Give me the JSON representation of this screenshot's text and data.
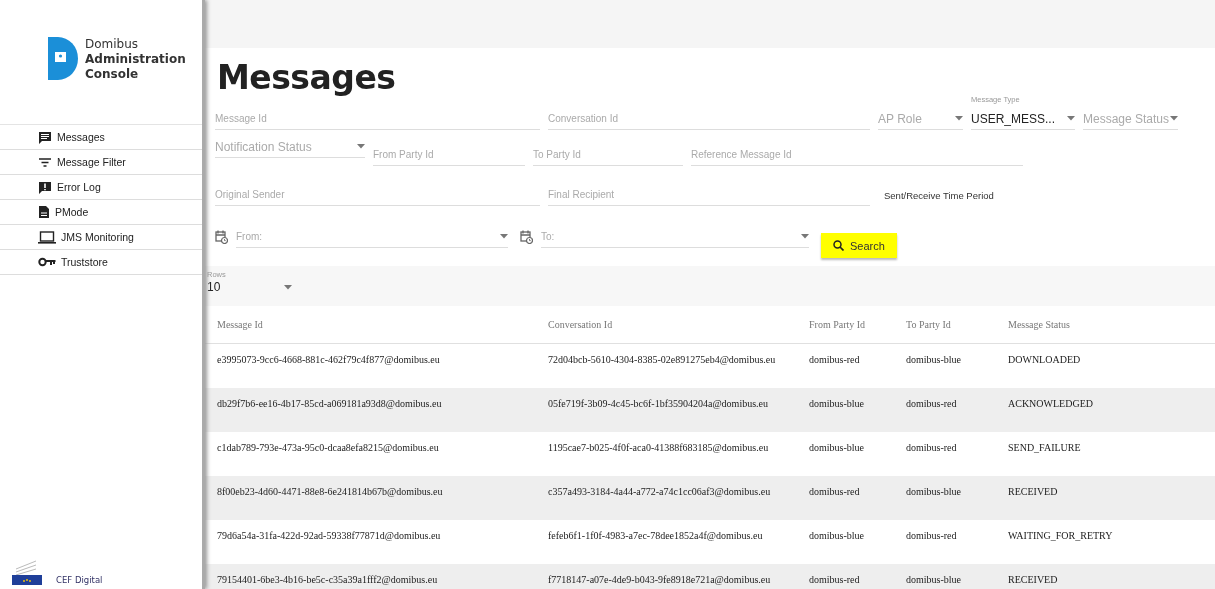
{
  "sidebar": {
    "app_name": [
      "Domibus",
      "Administration",
      "Console"
    ],
    "items": [
      {
        "label": "Messages"
      },
      {
        "label": "Message Filter"
      },
      {
        "label": "Error Log"
      },
      {
        "label": "PMode"
      },
      {
        "label": "JMS Monitoring"
      },
      {
        "label": "Truststore"
      }
    ],
    "footer": "CEF Digital"
  },
  "page_title": "Messages",
  "filters": [
    [
      {
        "kind": "text",
        "placeholder": "Message Id"
      },
      {
        "kind": "text",
        "placeholder": "Conversation Id"
      },
      {
        "kind": "select",
        "placeholder": "AP Role"
      },
      {
        "kind": "select",
        "label": "Message Type",
        "value": "USER_MESS..."
      },
      {
        "kind": "select",
        "placeholder": "Message Status"
      }
    ],
    [
      {
        "kind": "select",
        "placeholder": "Notification Status"
      },
      {
        "kind": "text",
        "placeholder": "From Party Id"
      },
      {
        "kind": "text",
        "placeholder": "To Party Id"
      },
      {
        "kind": "text",
        "placeholder": "Reference Message Id"
      }
    ],
    [
      {
        "kind": "text",
        "placeholder": "Original Sender"
      },
      {
        "kind": "text",
        "placeholder": "Final Recipient"
      },
      {
        "kind": "caption",
        "text": "Sent/Receive Time Period"
      }
    ],
    [
      {
        "kind": "date",
        "placeholder": "From:"
      },
      {
        "kind": "date",
        "placeholder": "To:"
      },
      {
        "kind": "button",
        "text": "Search"
      }
    ]
  ],
  "rows_selector": {
    "label": "Rows",
    "value": "10"
  },
  "table": {
    "columns": [
      "Message Id",
      "Conversation Id",
      "From Party Id",
      "To Party Id",
      "Message Status"
    ],
    "rows": [
      [
        "e3995073-9cc6-4668-881c-462f79c4f877@domibus.eu",
        "72d04bcb-5610-4304-8385-02e891275eb4@domibus.eu",
        "domibus-red",
        "domibus-blue",
        "DOWNLOADED"
      ],
      [
        "db29f7b6-ee16-4b17-85cd-a069181a93d8@domibus.eu",
        "05fe719f-3b09-4c45-bc6f-1bf35904204a@domibus.eu",
        "domibus-blue",
        "domibus-red",
        "ACKNOWLEDGED"
      ],
      [
        "c1dab789-793e-473a-95c0-dcaa8efa8215@domibus.eu",
        "1195cae7-b025-4f0f-aca0-41388f683185@domibus.eu",
        "domibus-blue",
        "domibus-red",
        "SEND_FAILURE"
      ],
      [
        "8f00eb23-4d60-4471-88e8-6e241814b67b@domibus.eu",
        "c357a493-3184-4a44-a772-a74c1cc06af3@domibus.eu",
        "domibus-red",
        "domibus-blue",
        "RECEIVED"
      ],
      [
        "79d6a54a-31fa-422d-92ad-59338f77871d@domibus.eu",
        "fefeb6f1-1f0f-4983-a7ec-78dee1852a4f@domibus.eu",
        "domibus-blue",
        "domibus-red",
        "WAITING_FOR_RETRY"
      ],
      [
        "79154401-6be3-4b16-be5c-c35a39a1fff2@domibus.eu",
        "f7718147-a07e-4de9-b043-9fe8918e721a@domibus.eu",
        "domibus-red",
        "domibus-blue",
        "RECEIVED"
      ]
    ]
  }
}
